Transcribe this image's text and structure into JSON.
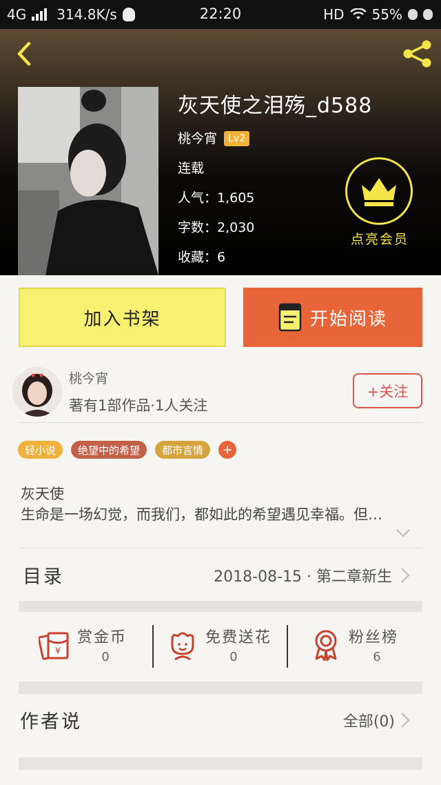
{
  "status_bar": {
    "network": "4G",
    "speed": "314.8K/s",
    "time": "22:20",
    "hd": "HD",
    "battery": "55%"
  },
  "book": {
    "title": "灰天使之泪殇_d588",
    "author": "桃今宵",
    "author_level": "Lv2",
    "status": "连载",
    "popularity": "人气：1,605",
    "word_count": "字数：2,030",
    "favorites": "收藏：6"
  },
  "vip": {
    "label": "点亮会员",
    "icon": "crown-icon"
  },
  "actions": {
    "add_shelf": "加入书架",
    "start_reading": "开始阅读"
  },
  "author": {
    "name": "桃今宵",
    "stats": "著有1部作品·1人关注",
    "follow": "+关注"
  },
  "tags": [
    {
      "label": "轻小说",
      "color": "#f0b03c"
    },
    {
      "label": "绝望中的希望",
      "color": "#c2604a"
    },
    {
      "label": "都市言情",
      "color": "#d4a43e"
    }
  ],
  "tag_add": "+",
  "synopsis": {
    "title": "灰天使",
    "body": "生命是一场幻觉，而我们，都如此的希望遇见幸福。但…"
  },
  "catalog": {
    "label": "目录",
    "latest": "2018-08-15 · 第二章新生"
  },
  "stats": [
    {
      "label": "赏金币",
      "value": "0",
      "icon": "red-envelope-icon"
    },
    {
      "label": "免费送花",
      "value": "0",
      "icon": "flower-icon"
    },
    {
      "label": "粉丝榜",
      "value": "6",
      "icon": "medal-icon"
    }
  ],
  "author_says": {
    "label": "作者说",
    "all": "全部(0)"
  },
  "colors": {
    "accent_orange": "#e8653a",
    "accent_yellow": "#f8f071",
    "vip_yellow": "#f5e54a",
    "icon_red": "#c8402e"
  }
}
